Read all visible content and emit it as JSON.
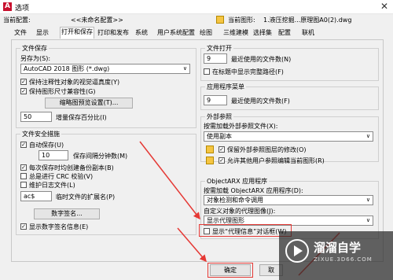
{
  "window": {
    "title": "选项",
    "app_icon": "autocad-icon",
    "close_glyph": "✕"
  },
  "profile": {
    "current_config_label": "当前配置:",
    "current_config_value": "<<未命名配置>>",
    "current_drawing_label": "当前图形:",
    "current_drawing_value": "1.液压挖掘...原理图A0(2).dwg"
  },
  "tabs": [
    "文件",
    "显示",
    "打开和保存",
    "打印和发布",
    "系统",
    "用户系统配置",
    "绘图",
    "三维建模",
    "选择集",
    "配置",
    "联机"
  ],
  "active_tab": "打开和保存",
  "file_save": {
    "title": "文件保存",
    "save_as_label": "另存为(S):",
    "save_as_value": "AutoCAD 2018 图形 (*.dwg)",
    "cb_annotative": "保持注释性对象的视觉逼真度(Y)",
    "cb_drawing_size": "保持图形尺寸兼容性(G)",
    "thumbnail_button": "缩略图预览设置(T)...",
    "incremental_value": "50",
    "incremental_label": "增量保存百分比(I)"
  },
  "file_safety": {
    "title": "文件安全措施",
    "cb_autosave": "自动保存(U)",
    "interval_value": "10",
    "interval_label": "保存间隔分钟数(M)",
    "cb_backup": "每次保存时均创建备份副本(B)",
    "cb_crc": "总是进行 CRC 校验(V)",
    "cb_log": "维护日志文件(L)",
    "temp_ext_value": "ac$",
    "temp_ext_label": "临时文件的扩展名(P)",
    "digital_sign_button": "数字签名...",
    "cb_show_sign": "显示数字签名信息(E)"
  },
  "file_open": {
    "title": "文件打开",
    "recent_value": "9",
    "recent_label": "最近使用的文件数(N)",
    "cb_full_path": "在标题中显示完整路径(F)"
  },
  "app_menu": {
    "title": "应用程序菜单",
    "recent_value": "9",
    "recent_label": "最近使用的文件数(F)"
  },
  "xref": {
    "title": "外部参照",
    "demand_load_label": "按需加载外部参照文件(X):",
    "demand_load_value": "使用副本",
    "cb_keep_changes": "保留外部参照图层的修改(O)",
    "cb_allow_edit": "允许其他用户参照编辑当前图形(R)"
  },
  "objectarx": {
    "title": "ObjectARX 应用程序",
    "demand_load_label": "按需加载 ObjectARX 应用程序(D):",
    "demand_load_value": "对象检测和命令调用",
    "proxy_label": "自定义对象的代理图像(J):",
    "proxy_value": "显示代理图形",
    "cb_proxy_info": "显示“代理信息”对话框(W)"
  },
  "footer": {
    "ok": "确定",
    "cancel": "取"
  },
  "watermark": {
    "name": "溜溜自学",
    "url": "ZIXUE.3D66.COM"
  },
  "colors": {
    "highlight": "#e53935",
    "accent": "#c8102e"
  }
}
